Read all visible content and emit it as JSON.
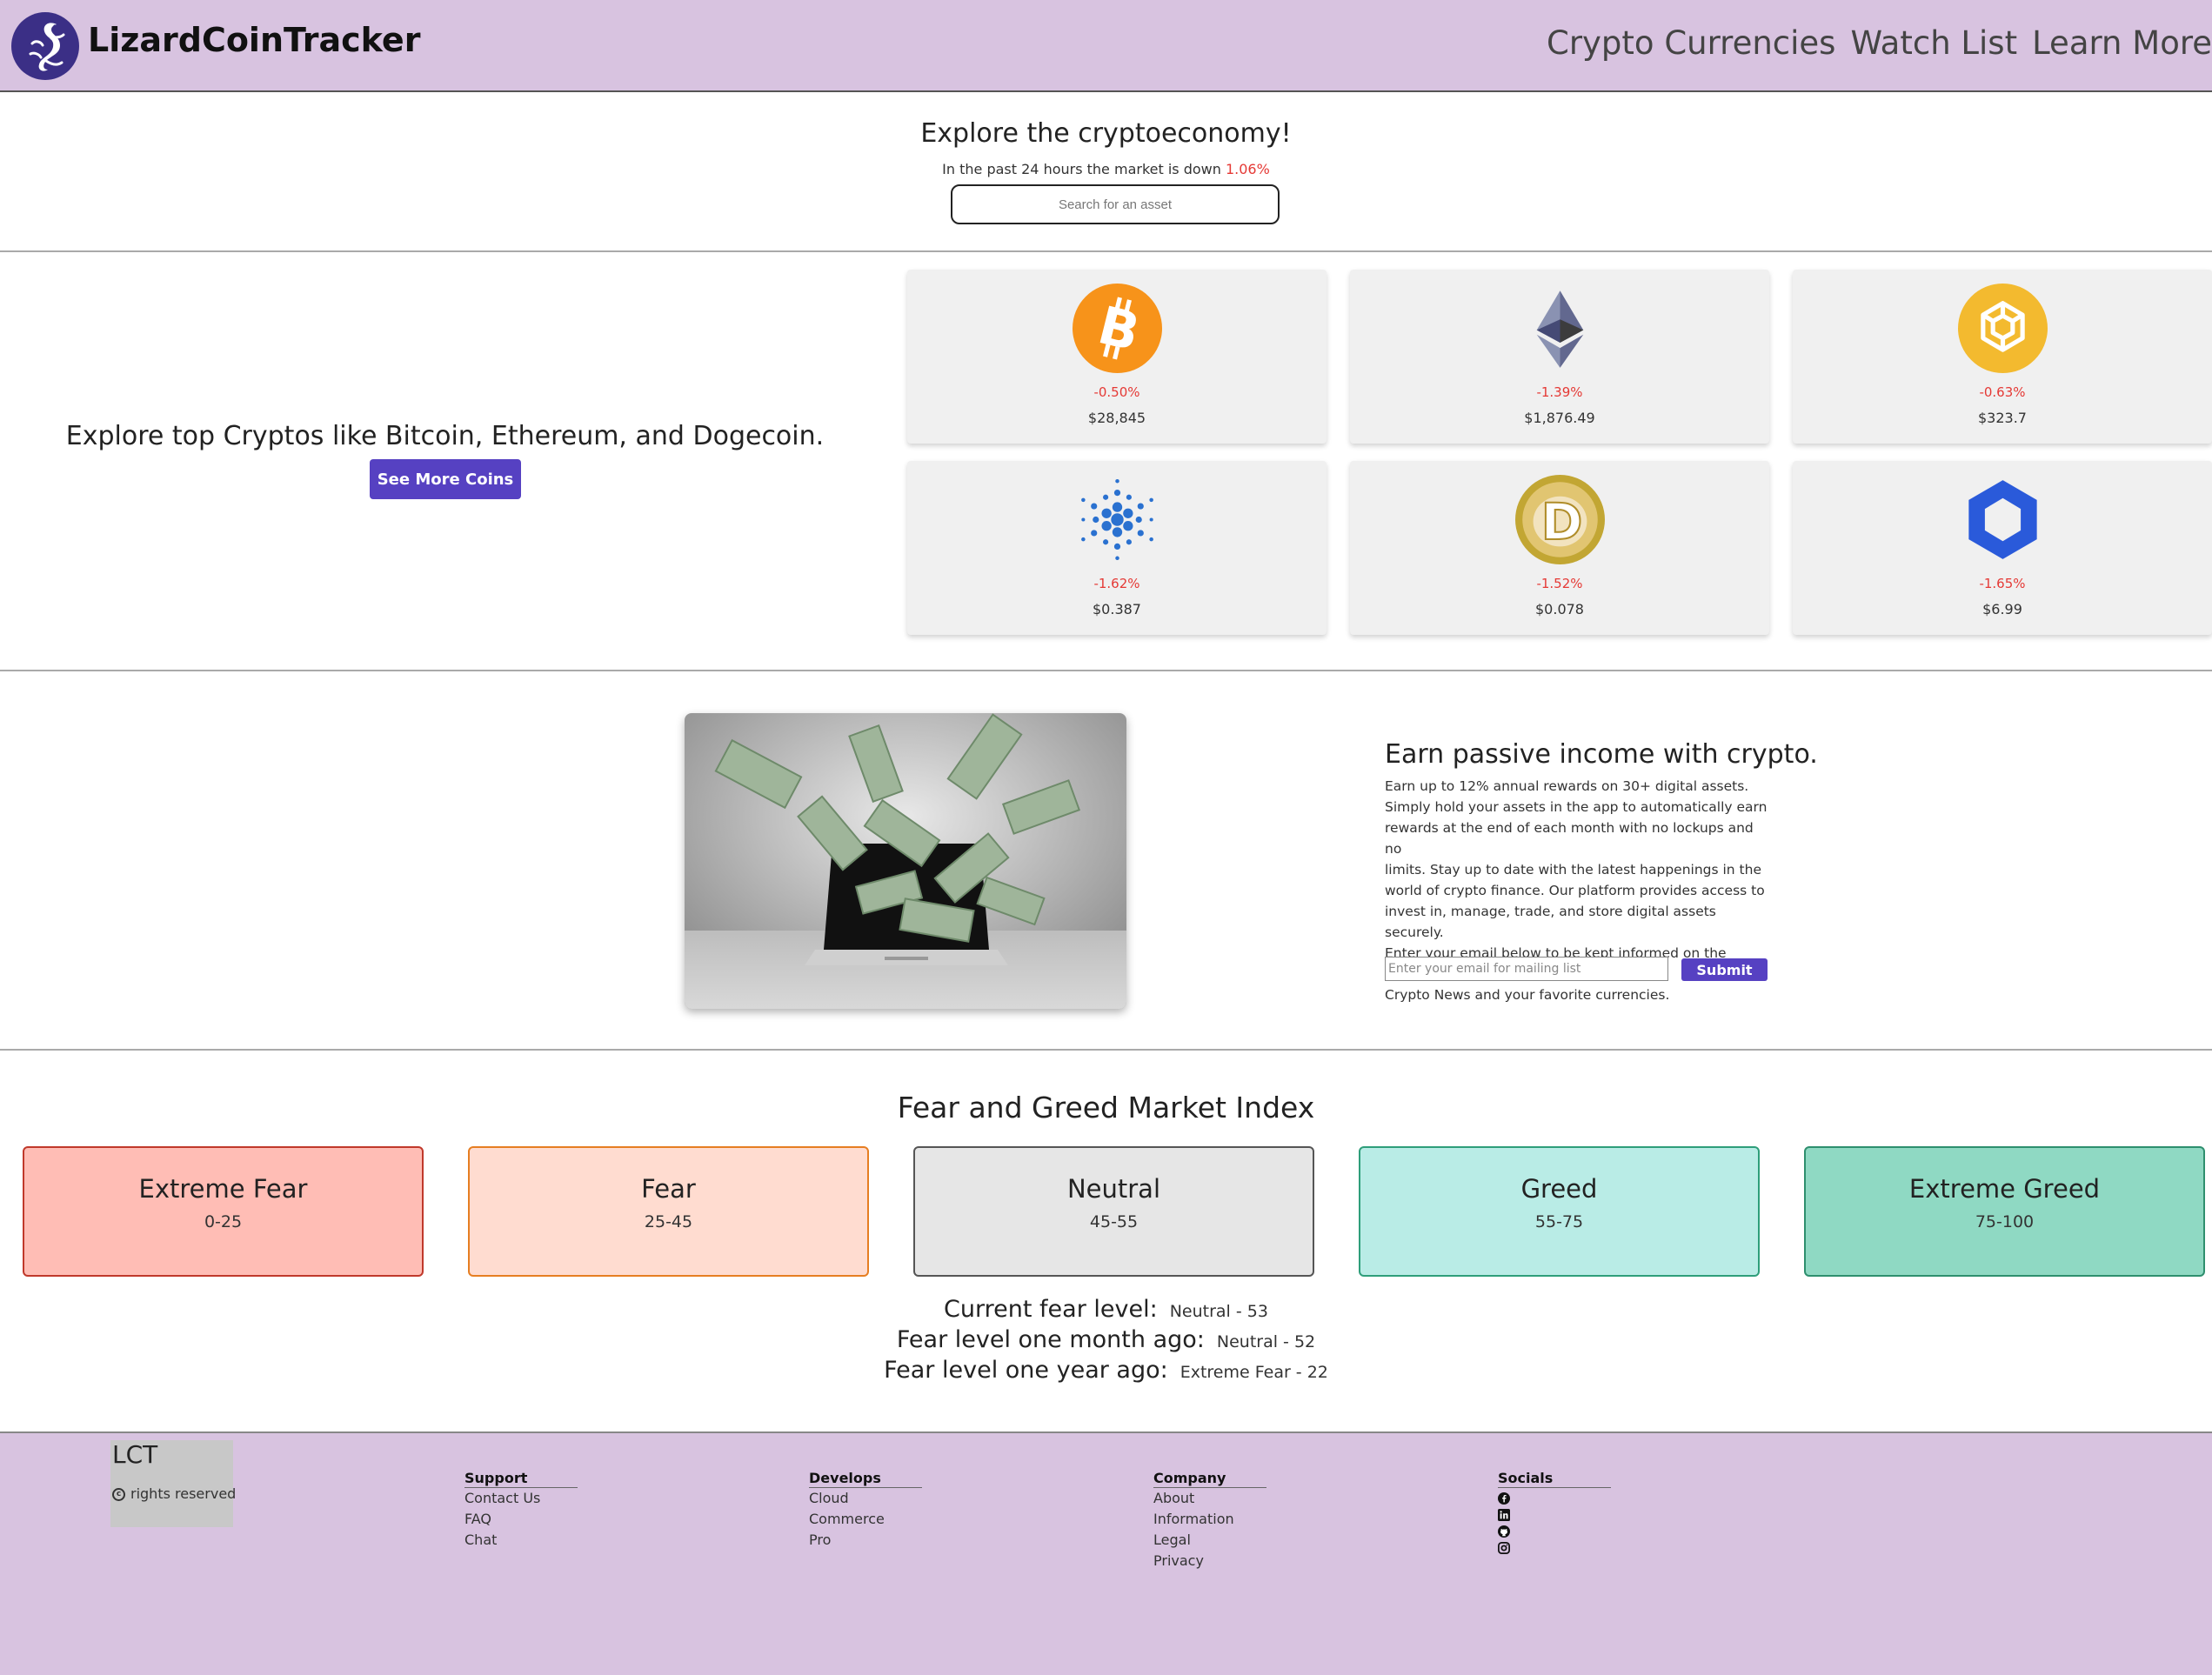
{
  "nav": {
    "brand": "LizardCoinTracker",
    "links": [
      "Crypto Currencies",
      "Watch List",
      "Learn More"
    ]
  },
  "hero": {
    "title": "Explore the cryptoeconomy!",
    "subtitle": "In the past 24 hours the market is down",
    "change": "1.06%",
    "search_placeholder": "Search for an asset"
  },
  "crypto": {
    "text": "Explore top Cryptos like Bitcoin, Ethereum, and Dogecoin.",
    "button": "See More Coins",
    "coins": [
      {
        "icon": "bitcoin-icon",
        "change": "-0.50%",
        "price": "$28,845"
      },
      {
        "icon": "ethereum-icon",
        "change": "-1.39%",
        "price": "$1,876.49"
      },
      {
        "icon": "binance-coin-icon",
        "change": "-0.63%",
        "price": "$323.7"
      },
      {
        "icon": "cardano-icon",
        "change": "-1.62%",
        "price": "$0.387"
      },
      {
        "icon": "dogecoin-icon",
        "change": "-1.52%",
        "price": "$0.078"
      },
      {
        "icon": "chainlink-icon",
        "change": "-1.65%",
        "price": "$6.99"
      }
    ]
  },
  "passive": {
    "title": "Earn passive income with crypto.",
    "lines": [
      "Earn up to 12% annual rewards on 30+ digital assets.",
      "Simply hold your assets in the app to automatically earn",
      "rewards at the end of each month with no lockups and no",
      "limits. Stay up to date with the latest happenings in the",
      "world of crypto finance. Our platform provides access to",
      "invest in, manage, trade, and store digital assets securely.",
      "Enter your email below to be kept informed on the latest",
      "Crypto News and your favorite currencies."
    ],
    "email_placeholder": "Enter your email for mailing list",
    "submit": "Submit"
  },
  "fear_greed": {
    "title": "Fear and Greed Market Index",
    "levels": [
      {
        "name": "Extreme Fear",
        "range": "0-25",
        "bg": "#ffbdb5",
        "border": "#c0392b"
      },
      {
        "name": "Fear",
        "range": "25-45",
        "bg": "#ffdcd0",
        "border": "#e67e22"
      },
      {
        "name": "Neutral",
        "range": "45-55",
        "bg": "#e6e6e6",
        "border": "#555555"
      },
      {
        "name": "Greed",
        "range": "55-75",
        "bg": "#b9ece6",
        "border": "#2e9e7a"
      },
      {
        "name": "Extreme Greed",
        "range": "75-100",
        "bg": "#8fd9c3",
        "border": "#2e8f6e"
      }
    ],
    "current_label": "Current fear level:",
    "current_value": "Neutral - 53",
    "month_label": "Fear level one month ago:",
    "month_value": "Neutral - 52",
    "year_label": "Fear level one year ago:",
    "year_value": "Extreme Fear - 22"
  },
  "footer": {
    "brand": "LCT",
    "rights": "rights reserved",
    "columns": [
      {
        "head": "Support",
        "items": [
          "Contact Us",
          "FAQ",
          "Chat"
        ]
      },
      {
        "head": "Develops",
        "items": [
          "Cloud",
          "Commerce",
          "Pro"
        ]
      },
      {
        "head": "Company",
        "items": [
          "About",
          "Information",
          "Legal",
          "Privacy"
        ]
      },
      {
        "head": "Socials",
        "icons": [
          "facebook-icon",
          "linkedin-icon",
          "github-icon",
          "instagram-icon"
        ]
      }
    ]
  },
  "colors": {
    "nav_bg": "#d8c3e0",
    "accent": "#5641c2",
    "negative": "#e53935"
  }
}
